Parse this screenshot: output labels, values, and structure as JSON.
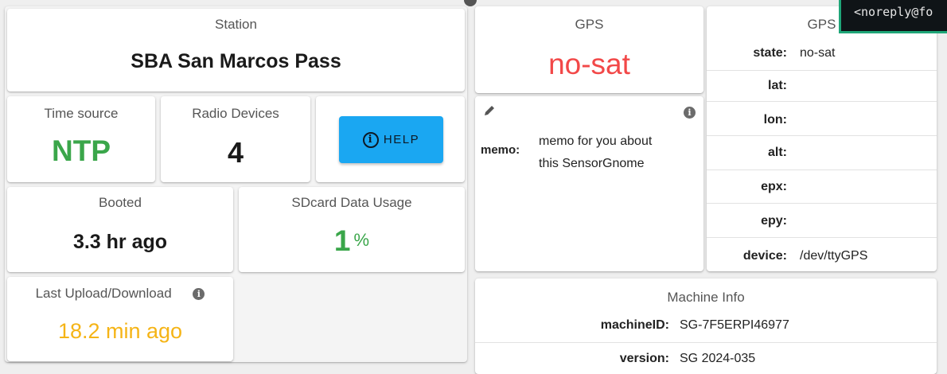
{
  "station": {
    "label": "Station",
    "name": "SBA San Marcos Pass"
  },
  "time_source": {
    "label": "Time source",
    "value": "NTP"
  },
  "radio_devices": {
    "label": "Radio Devices",
    "value": "4"
  },
  "help": {
    "label": "HELP",
    "icon": "info-circle-icon"
  },
  "booted": {
    "label": "Booted",
    "value": "3.3 hr ago"
  },
  "sdcard": {
    "label": "SDcard Data Usage",
    "value": "1",
    "unit": "%"
  },
  "last_upload": {
    "label": "Last Upload/Download",
    "value": "18.2 min ago",
    "info_icon": "info-icon"
  },
  "gps_status": {
    "label": "GPS",
    "value": "no-sat"
  },
  "memo": {
    "edit_icon": "pencil-icon",
    "info_icon": "info-icon",
    "label": "memo:",
    "text_line1": "memo for you about",
    "text_line2": "this SensorGnome"
  },
  "gps_detail": {
    "title": "GPS",
    "rows": [
      {
        "key": "state:",
        "value": "no-sat"
      },
      {
        "key": "lat:",
        "value": ""
      },
      {
        "key": "lon:",
        "value": ""
      },
      {
        "key": "alt:",
        "value": ""
      },
      {
        "key": "epx:",
        "value": ""
      },
      {
        "key": "epy:",
        "value": ""
      },
      {
        "key": "device:",
        "value": "/dev/ttyGPS"
      }
    ]
  },
  "machine_info": {
    "title": "Machine Info",
    "rows": [
      {
        "key": "machineID:",
        "value": "SG-7F5ERPI46977"
      },
      {
        "key": "version:",
        "value": "SG 2024-035"
      }
    ]
  },
  "tooltip": {
    "text": "<noreply@fo"
  },
  "colors": {
    "green": "#3aa64a",
    "red": "#f24848",
    "amber": "#f5b416",
    "help_button": "#1aa7f2"
  }
}
